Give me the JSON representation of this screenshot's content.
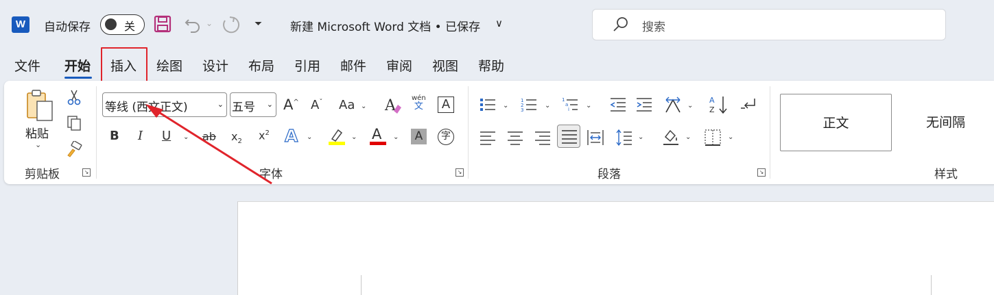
{
  "titlebar": {
    "app_logo": "W",
    "autosave_label": "自动保存",
    "autosave_state": "关",
    "doc_title": "新建 Microsoft Word 文档 • 已保存",
    "title_chevron": "∨",
    "search_placeholder": "搜索"
  },
  "tabs": [
    {
      "label": "文件"
    },
    {
      "label": "开始",
      "active": true
    },
    {
      "label": "插入",
      "highlighted": true
    },
    {
      "label": "绘图"
    },
    {
      "label": "设计"
    },
    {
      "label": "布局"
    },
    {
      "label": "引用"
    },
    {
      "label": "邮件"
    },
    {
      "label": "审阅"
    },
    {
      "label": "视图"
    },
    {
      "label": "帮助"
    }
  ],
  "ribbon": {
    "clipboard": {
      "paste_label": "粘贴",
      "group_label": "剪贴板"
    },
    "font": {
      "font_name": "等线 (西文正文)",
      "font_size": "五号",
      "grow_label": "A",
      "shrink_label": "A",
      "case_label": "Aa",
      "phonetic_top": "wén",
      "phonetic_bottom": "文",
      "border_char": "A",
      "bold": "B",
      "italic": "I",
      "underline": "U",
      "strike": "ab",
      "subscript": "x",
      "superscript": "x",
      "effects": "A",
      "font_color": "A",
      "shading": "A",
      "enclose": "字",
      "group_label": "字体",
      "highlight_color": "#ffff00",
      "font_color_value": "#e00000"
    },
    "paragraph": {
      "group_label": "段落"
    },
    "styles": {
      "cards": [
        {
          "label": "正文",
          "selected": true
        },
        {
          "label": "无间隔"
        }
      ],
      "group_label": "样式"
    }
  },
  "annotation": {
    "color": "#e0242b"
  }
}
